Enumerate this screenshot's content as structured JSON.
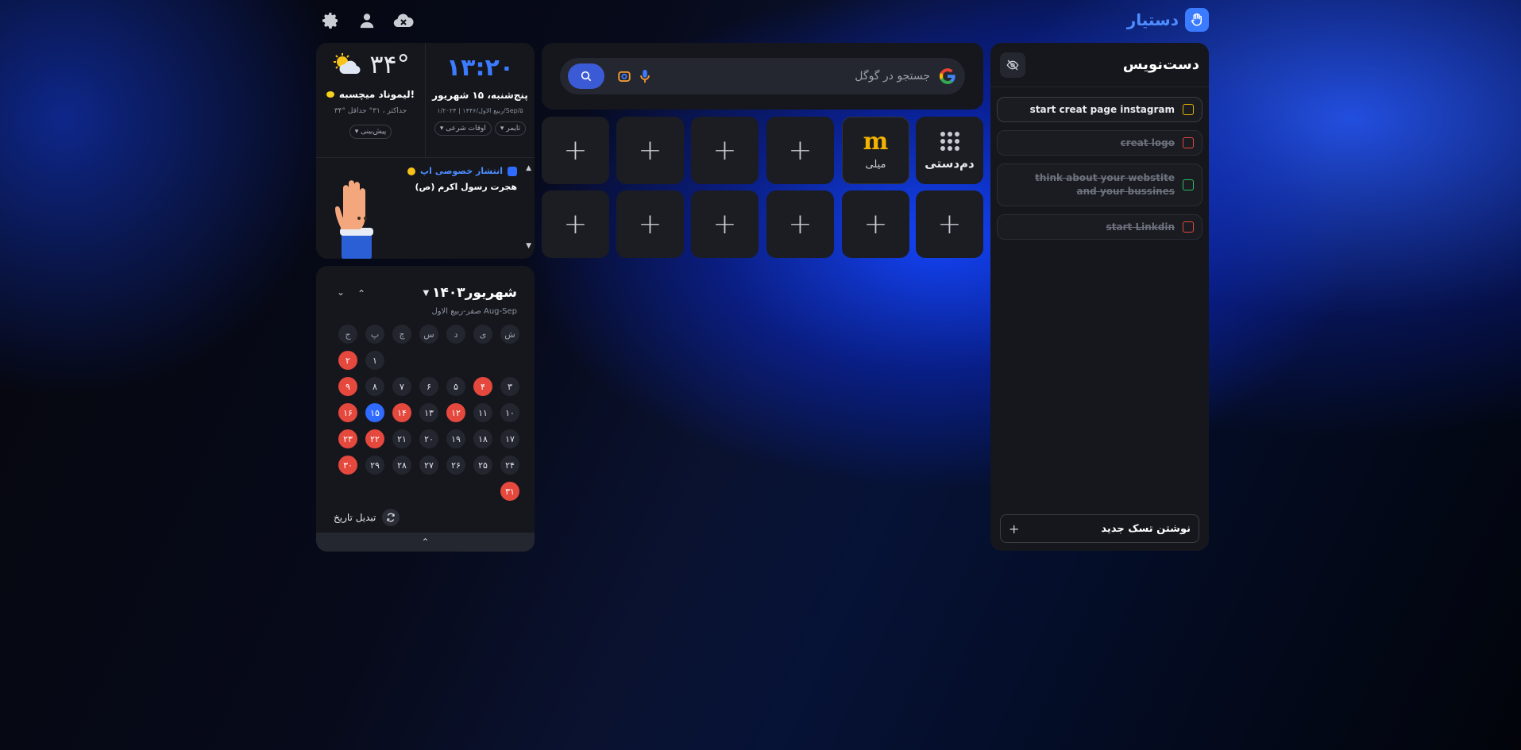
{
  "brand": {
    "name": "دستیار"
  },
  "todo": {
    "title": "دست‌نویس",
    "tasks": [
      {
        "text": "start creat page instagram",
        "color": "#e0b000"
      },
      {
        "text": "creat logo",
        "color": "#e5483d"
      },
      {
        "text": "think about your webstite and your bussines",
        "color": "#2fbf5a"
      },
      {
        "text": "start Linkdin",
        "color": "#e5483d"
      }
    ],
    "new_task_label": "نوشتن تسک جدید",
    "add_symbol": "+"
  },
  "search": {
    "placeholder": "جستجو در گوگل"
  },
  "shortcuts": {
    "row1": [
      {
        "label": "دم‌دستی",
        "icon": "grid-icon"
      },
      {
        "label": "میلی",
        "icon": "m-logo-icon"
      },
      {
        "label": "",
        "icon": "plus-icon"
      },
      {
        "label": "",
        "icon": "plus-icon"
      },
      {
        "label": "",
        "icon": "plus-icon"
      },
      {
        "label": "",
        "icon": "plus-icon"
      }
    ],
    "plus": "+"
  },
  "clock": {
    "time": "۱۳:۲۰",
    "date": "پنج‌شنبه، ۱۵ شهریور",
    "sub_date": "۱/ربیع الاول/۱۴۴۶ | ۲۰۲۴/Sep/۵",
    "timer_chip": "تایمر",
    "prayer_chip": "اوقات شرعی"
  },
  "weather": {
    "temp": "۳۴°",
    "desc": "لیموناد میچسبه!",
    "minmax": "۳۴° حداکثر ، ۳۱° حداقل",
    "forecast_chip": "پیش‌بینی"
  },
  "event": {
    "title": "انتشار خصوصی اپ",
    "subtitle": "هجرت رسول اکرم (ص)"
  },
  "calendar": {
    "month_title": "شهریور۱۴۰۳",
    "sub": "صفر-ربیع الاول  Aug-Sep",
    "weekdays": [
      "ش",
      "ی",
      "د",
      "س",
      "چ",
      "پ",
      "ج"
    ],
    "convert_label": "تبدیل تاریخ"
  },
  "colors": {
    "accent": "#3b7bff",
    "holiday": "#e5483d",
    "today": "#2f6bff"
  }
}
